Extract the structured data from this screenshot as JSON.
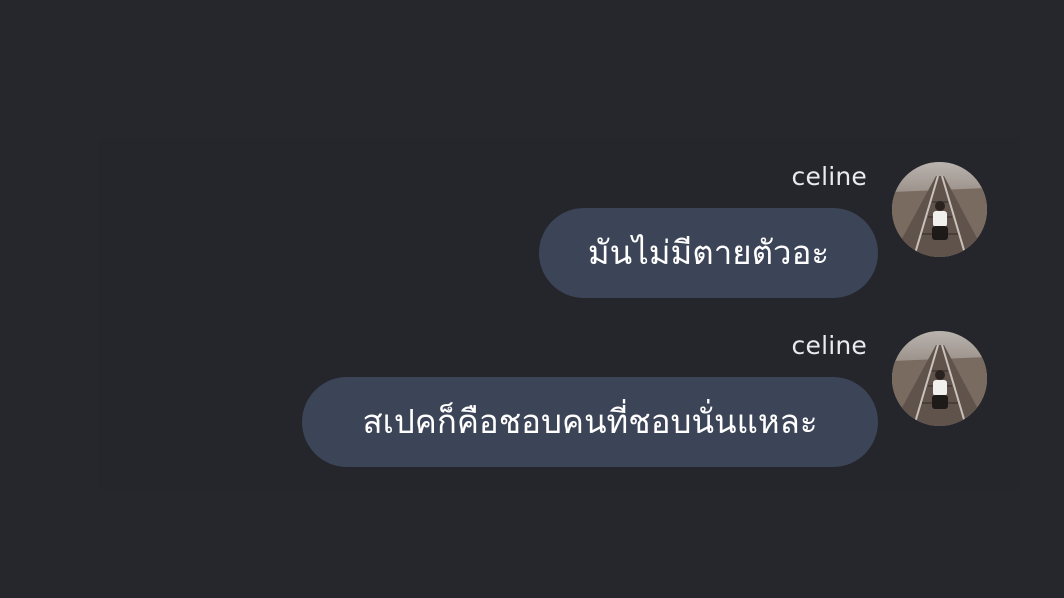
{
  "conversation": {
    "messages": [
      {
        "sender": "celine",
        "text": "มันไม่มีตายตัวอะ",
        "avatar_icon": "user-photo-avatar"
      },
      {
        "sender": "celine",
        "text": "สเปคก็คือชอบคนที่ชอบนั่นแหละ",
        "avatar_icon": "user-photo-avatar"
      }
    ]
  },
  "colors": {
    "background": "#26272c",
    "bubble": "#3c4457",
    "bubble_text": "#ffffff",
    "sender_text": "#e9eaee"
  }
}
